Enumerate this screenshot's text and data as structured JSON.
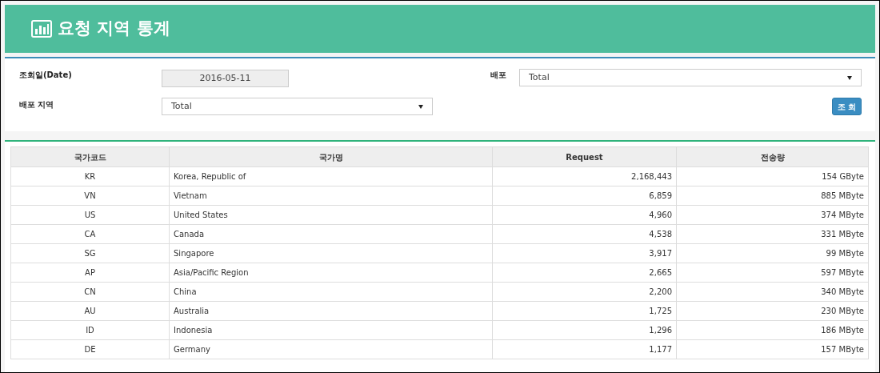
{
  "page_title": "요청 지역 통계",
  "filters": {
    "date_label": "조회일(Date)",
    "date_value": "2016-05-11",
    "deploy_label": "배포",
    "deploy_value": "Total",
    "region_label": "배포 지역",
    "region_value": "Total",
    "search_button": "조 회"
  },
  "table": {
    "columns": [
      "국가코드",
      "국가명",
      "Request",
      "전송량"
    ],
    "rows": [
      [
        "KR",
        "Korea, Republic of",
        "2,168,443",
        "154 GByte"
      ],
      [
        "VN",
        "Vietnam",
        "6,859",
        "885 MByte"
      ],
      [
        "US",
        "United States",
        "4,960",
        "374 MByte"
      ],
      [
        "CA",
        "Canada",
        "4,538",
        "331 MByte"
      ],
      [
        "SG",
        "Singapore",
        "3,917",
        "99 MByte"
      ],
      [
        "AP",
        "Asia/Pacific Region",
        "2,665",
        "597 MByte"
      ],
      [
        "CN",
        "China",
        "2,200",
        "340 MByte"
      ],
      [
        "AU",
        "Australia",
        "1,725",
        "230 MByte"
      ],
      [
        "ID",
        "Indonesia",
        "1,296",
        "186 MByte"
      ],
      [
        "DE",
        "Germany",
        "1,177",
        "157 MByte"
      ]
    ]
  }
}
